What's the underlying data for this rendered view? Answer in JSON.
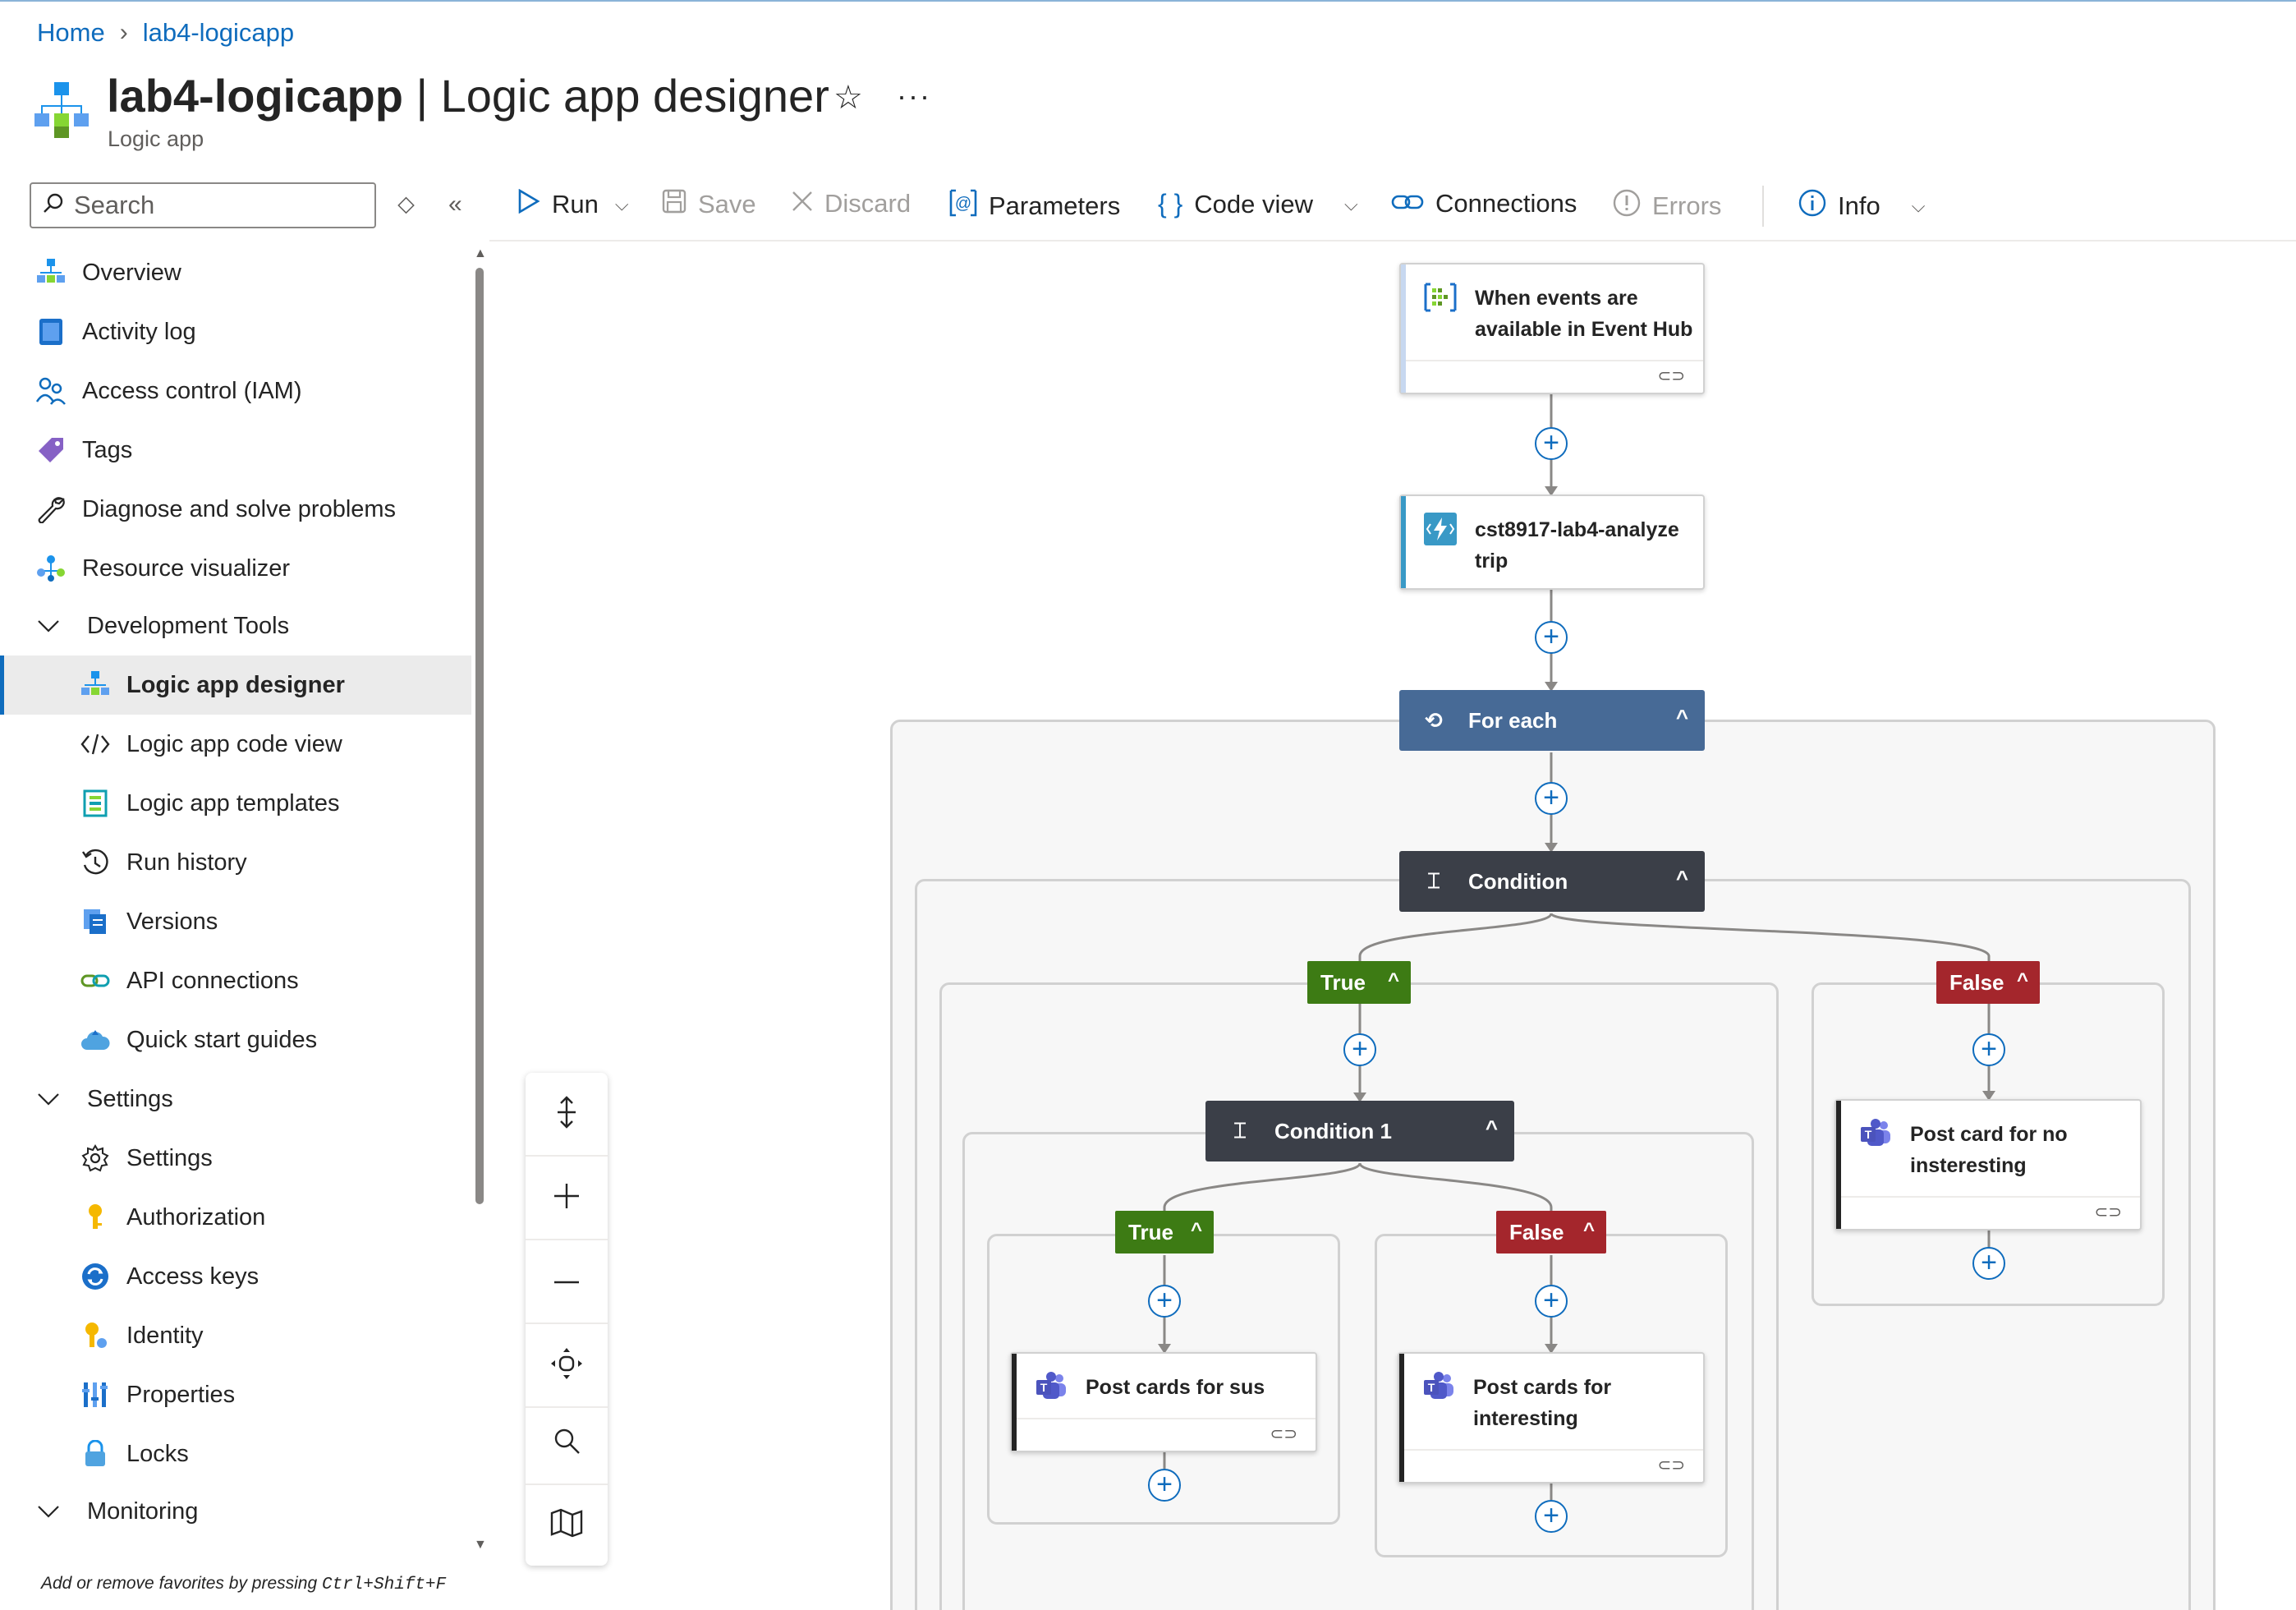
{
  "breadcrumb": {
    "home": "Home",
    "current": "lab4-logicapp"
  },
  "header": {
    "title_bold": "lab4-logicapp",
    "title_rest": " | Logic app designer",
    "subtitle": "Logic app",
    "star": "☆",
    "more": "···"
  },
  "search": {
    "placeholder": "Search"
  },
  "nav": {
    "overview": "Overview",
    "activity_log": "Activity log",
    "access_control": "Access control (IAM)",
    "tags": "Tags",
    "diagnose": "Diagnose and solve problems",
    "resource_visualizer": "Resource visualizer",
    "dev_tools": "Development Tools",
    "designer": "Logic app designer",
    "code_view": "Logic app code view",
    "templates": "Logic app templates",
    "run_history": "Run history",
    "versions": "Versions",
    "api_connections": "API connections",
    "quick_start": "Quick start guides",
    "settings_group": "Settings",
    "settings": "Settings",
    "authorization": "Authorization",
    "access_keys": "Access keys",
    "identity": "Identity",
    "properties": "Properties",
    "locks": "Locks",
    "monitoring": "Monitoring"
  },
  "fav_hint": {
    "text": "Add or remove favorites by pressing ",
    "keys": "Ctrl+Shift+F"
  },
  "toolbar": {
    "run": "Run",
    "save": "Save",
    "discard": "Discard",
    "parameters": "Parameters",
    "code_view": "Code view",
    "connections": "Connections",
    "errors": "Errors",
    "info": "Info"
  },
  "workflow": {
    "trigger": [
      "When events are",
      "available in Event Hub"
    ],
    "function": [
      "cst8917-lab4-analyze",
      "trip"
    ],
    "foreach": "For each",
    "condition": "Condition",
    "true_label": "True",
    "false_label": "False",
    "condition1": "Condition 1",
    "post_sus": "Post cards for sus",
    "post_interesting": [
      "Post cards for",
      "interesting"
    ],
    "post_no": [
      "Post card for no",
      "insteresting"
    ]
  },
  "colors": {
    "accent": "#0f6cbd",
    "foreach_bar": "#476a96",
    "condition_bar": "#3b3f48",
    "true_branch": "#3d7b14",
    "false_branch": "#a4262c"
  }
}
